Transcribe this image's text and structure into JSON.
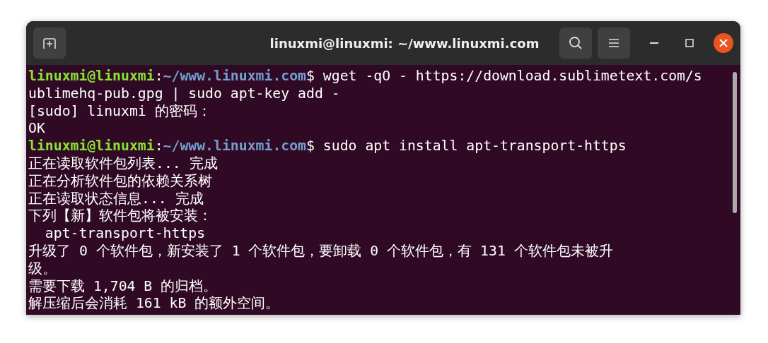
{
  "window": {
    "title": "linuxmi@linuxmi: ~/www.linuxmi.com"
  },
  "terminal": {
    "lines": [
      {
        "kind": "prompt",
        "user": "linuxmi@linuxmi",
        "separator": ":",
        "path": "~/www.linuxmi.com",
        "command": "$ wget -qO - https://download.sublimetext.com/s"
      },
      {
        "kind": "output",
        "text": "ublimehq-pub.gpg | sudo apt-key add -"
      },
      {
        "kind": "output",
        "text": "[sudo] linuxmi 的密码："
      },
      {
        "kind": "output",
        "text": "OK"
      },
      {
        "kind": "prompt",
        "user": "linuxmi@linuxmi",
        "separator": ":",
        "path": "~/www.linuxmi.com",
        "command": "$ sudo apt install apt-transport-https"
      },
      {
        "kind": "output",
        "text": "正在读取软件包列表... 完成"
      },
      {
        "kind": "output",
        "text": "正在分析软件包的依赖关系树"
      },
      {
        "kind": "output",
        "text": "正在读取状态信息... 完成"
      },
      {
        "kind": "output",
        "text": "下列【新】软件包将被安装："
      },
      {
        "kind": "output",
        "text": "  apt-transport-https"
      },
      {
        "kind": "output",
        "text": "升级了 0 个软件包，新安装了 1 个软件包，要卸载 0 个软件包，有 131 个软件包未被升"
      },
      {
        "kind": "output",
        "text": "级。"
      },
      {
        "kind": "output",
        "text": "需要下载 1,704 B 的归档。"
      },
      {
        "kind": "output",
        "text": "解压缩后会消耗 161 kB 的额外空间。"
      }
    ]
  }
}
